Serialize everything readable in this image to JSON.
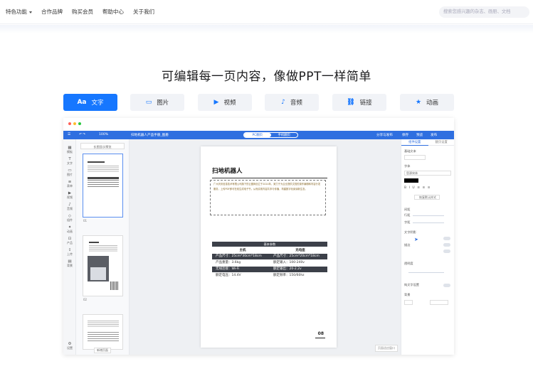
{
  "nav": {
    "items": [
      "特色功能",
      "合作品牌",
      "购买会员",
      "帮助中心",
      "关于我们"
    ],
    "search_placeholder": "搜索您感兴趣的杂志、画册、文档"
  },
  "hero": {
    "title": "可编辑每一页内容，像做PPT一样简单"
  },
  "tabs": [
    {
      "label": "文字",
      "icon": "Aa"
    },
    {
      "label": "图片",
      "icon": "▭"
    },
    {
      "label": "视频",
      "icon": "▶"
    },
    {
      "label": "音频",
      "icon": "♪"
    },
    {
      "label": "链接",
      "icon": "⛓"
    },
    {
      "label": "动画",
      "icon": "★"
    }
  ],
  "editor": {
    "doc_title": "扫地机器人产品手册_图册",
    "zoom": "100%",
    "view_toggle": [
      "PC翻页",
      "手机翻页"
    ],
    "top_right": [
      "分享与发布",
      "保存",
      "预览",
      "发布"
    ],
    "left_rail": [
      "模板",
      "文字",
      "图片",
      "表单",
      "视频",
      "音频",
      "组件",
      "动画",
      "产品",
      "上传",
      "背景",
      "设置"
    ],
    "thumbs_caption": "长图显示预览",
    "thumb_numbers": [
      "01",
      "02"
    ],
    "add_page": "新增页面",
    "page": {
      "title": "扫地机器人",
      "paragraph": "广州天彩信息技术有限公司旗下的云图网创立于2014年，致力于为企业提供文档的操作编辑和内容分发服务，上传PDF即可在线生成电子书，从而实现内容共享与传播，构建数字化阅读新生态。",
      "spec_title": "基本参数",
      "spec_head": [
        "主机",
        "充电座"
      ],
      "spec_rows": [
        [
          "产品尺寸：25cm*30cm*18cm",
          "产品尺寸：25cm*20cm*18cm"
        ],
        [
          "产品重量：3.6kg",
          "额定输入：100-240v"
        ],
        [
          "无线连接：Wi-Fi",
          "额定输出：20-2.2v"
        ],
        [
          "额定电压：14.4V",
          "额定频率：150/60hz"
        ]
      ],
      "page_no": "08"
    },
    "zoom_note": "页面适应窗口",
    "right_panel": {
      "tabs": [
        "组件设置",
        "翻页设置"
      ],
      "labels": [
        "基础文本",
        "字体",
        "间距",
        "文字阴影",
        "描边",
        "透明度",
        "背景",
        "行距",
        "字距",
        "纯文字设置"
      ],
      "font_value": "思源宋体",
      "style_button": "恢复默认样式"
    }
  }
}
